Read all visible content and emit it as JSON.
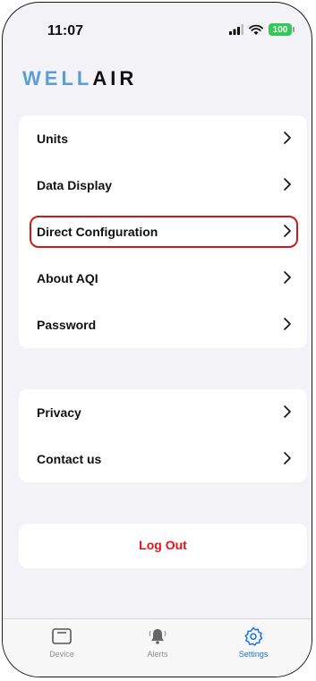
{
  "status_bar": {
    "time": "11:07",
    "battery": "100"
  },
  "logo": {
    "part1": "WELL",
    "part2": "AIR"
  },
  "settings_group_1": [
    {
      "label": "Units"
    },
    {
      "label": "Data Display"
    },
    {
      "label": "Direct Configuration"
    },
    {
      "label": "About AQI"
    },
    {
      "label": "Password"
    }
  ],
  "settings_group_2": [
    {
      "label": "Privacy"
    },
    {
      "label": "Contact us"
    }
  ],
  "logout_label": "Log Out",
  "tabbar": {
    "tabs": [
      {
        "label": "Device",
        "icon": "device-icon"
      },
      {
        "label": "Alerts",
        "icon": "bell-icon"
      },
      {
        "label": "Settings",
        "icon": "gear-icon",
        "active": true
      }
    ]
  },
  "colors": {
    "accent": "#1a73e8",
    "logout": "#e5131a",
    "highlight": "#cc1a1a",
    "logo_blue": "#5a9fd4"
  }
}
